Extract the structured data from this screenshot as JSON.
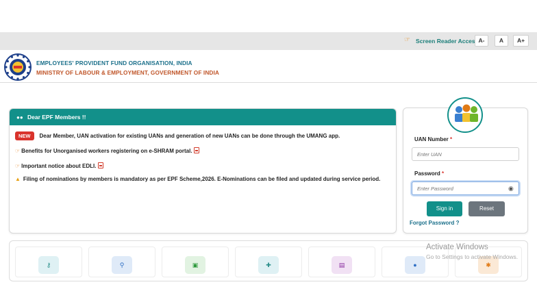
{
  "access_bar": {
    "label": "Screen Reader Access",
    "font_decrease": "A-",
    "font_normal": "A",
    "font_increase": "A+"
  },
  "header": {
    "org_name": "EMPLOYEES' PROVIDENT FUND ORGANISATION, INDIA",
    "ministry": "MINISTRY OF LABOUR & EMPLOYMENT, GOVERNMENT OF INDIA"
  },
  "notices": {
    "title": "Dear EPF Members !!",
    "badge": "NEW",
    "items": [
      "Dear Member, UAN activation for existing UANs and generation of new UANs can be done through the UMANG app.",
      "Benefits for Unorganised workers registering on e-SHRAM portal.",
      "Important notice about EDLI.",
      "Filing of nominations by members is mandatory as per EPF Scheme,2026. E-Nominations can be filed and updated during service period."
    ]
  },
  "login": {
    "uan_label": "UAN Number",
    "uan_placeholder": "Enter UAN",
    "password_label": "Password",
    "password_placeholder": "Enter Password",
    "required_mark": "*",
    "sign_in": "Sign in",
    "reset": "Reset",
    "forgot": "Forgot Password ?"
  },
  "watermark": {
    "line1": "Activate Windows",
    "line2": "Go to Settings to activate Windows."
  },
  "tiles": [
    {
      "icon": "key-icon",
      "color": "#2a8f8a",
      "bg": "#dff1f4"
    },
    {
      "icon": "search-icon",
      "color": "#2f6fc4",
      "bg": "#dfeaf8"
    },
    {
      "icon": "document-icon",
      "color": "#2f9a3e",
      "bg": "#e2f3e2"
    },
    {
      "icon": "add-user-icon",
      "color": "#2a8f8a",
      "bg": "#dff1f4"
    },
    {
      "icon": "id-card-icon",
      "color": "#8a2fa0",
      "bg": "#f1e1f4"
    },
    {
      "icon": "user-icon",
      "color": "#2f6fc4",
      "bg": "#dfeaf8"
    },
    {
      "icon": "group-icon",
      "color": "#e07a15",
      "bg": "#fbe9d6"
    }
  ]
}
